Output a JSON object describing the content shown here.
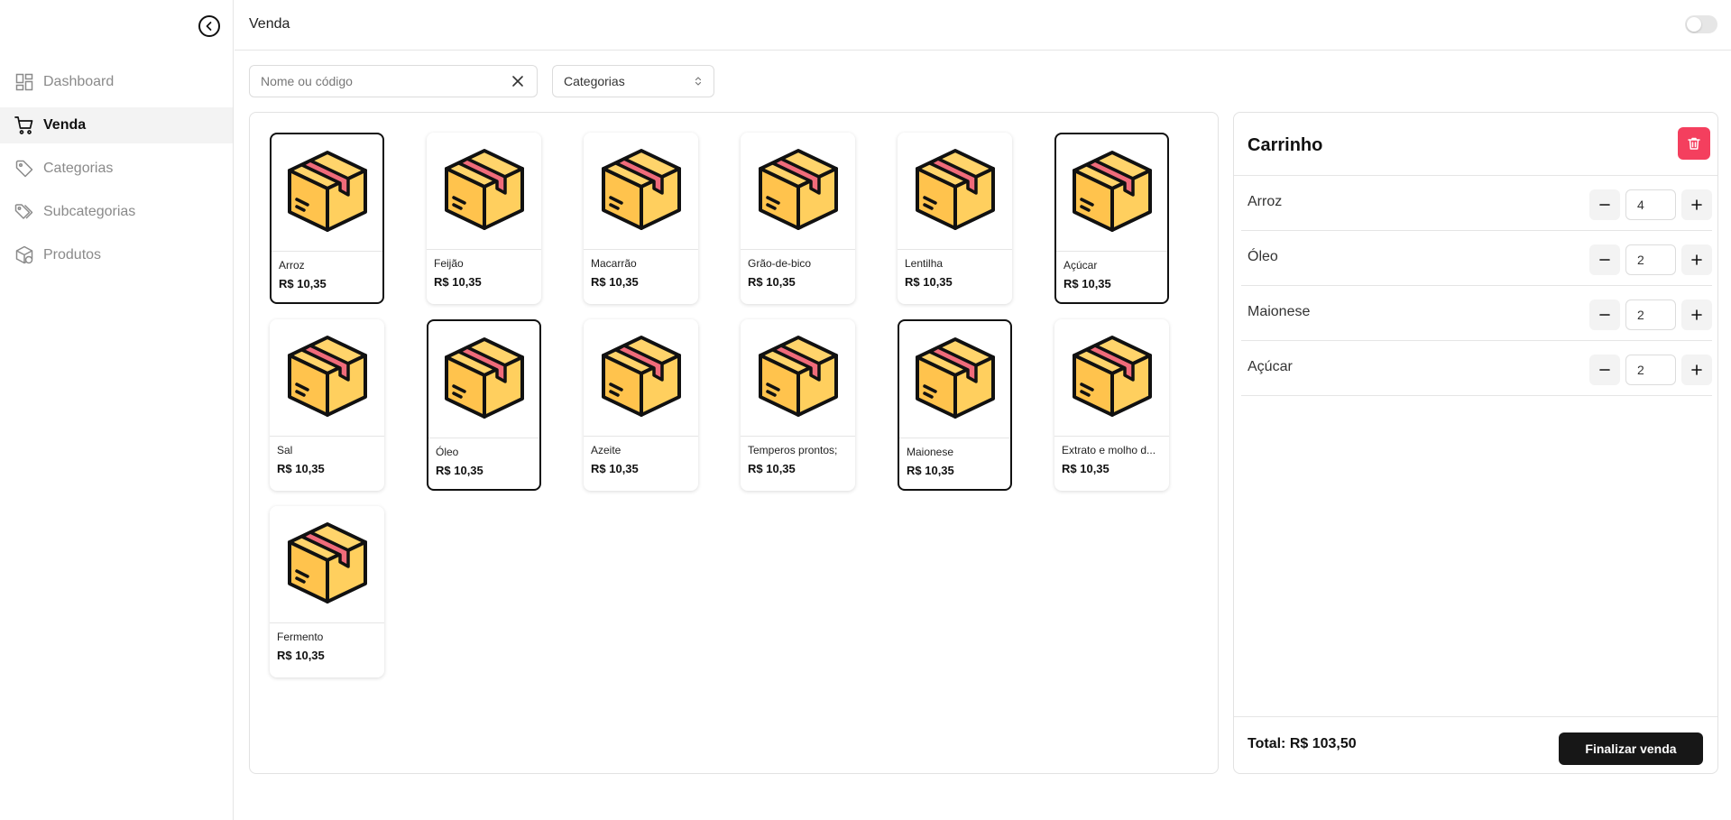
{
  "sidebar": {
    "items": [
      {
        "label": "Dashboard",
        "icon": "dashboard-icon"
      },
      {
        "label": "Venda",
        "icon": "cart-icon"
      },
      {
        "label": "Categorias",
        "icon": "tag-icon"
      },
      {
        "label": "Subcategorias",
        "icon": "tags-icon"
      },
      {
        "label": "Produtos",
        "icon": "package-icon"
      }
    ],
    "active": "Venda"
  },
  "header": {
    "title": "Venda",
    "theme_toggle": "off"
  },
  "filters": {
    "search_placeholder": "Nome ou código",
    "category_select": "Categorias"
  },
  "products": [
    {
      "name": "Arroz",
      "price": "R$ 10,35",
      "selected": true
    },
    {
      "name": "Feijão",
      "price": "R$ 10,35",
      "selected": false
    },
    {
      "name": "Macarrão",
      "price": "R$ 10,35",
      "selected": false
    },
    {
      "name": "Grão-de-bico",
      "price": "R$ 10,35",
      "selected": false
    },
    {
      "name": "Lentilha",
      "price": "R$ 10,35",
      "selected": false
    },
    {
      "name": "Açúcar",
      "price": "R$ 10,35",
      "selected": true
    },
    {
      "name": "Sal",
      "price": "R$ 10,35",
      "selected": false
    },
    {
      "name": "Óleo",
      "price": "R$ 10,35",
      "selected": true
    },
    {
      "name": "Azeite",
      "price": "R$ 10,35",
      "selected": false
    },
    {
      "name": "Temperos prontos;",
      "price": "R$ 10,35",
      "selected": false
    },
    {
      "name": "Maionese",
      "price": "R$ 10,35",
      "selected": true
    },
    {
      "name": "Extrato e molho d...",
      "price": "R$ 10,35",
      "selected": false
    },
    {
      "name": "Fermento",
      "price": "R$ 10,35",
      "selected": false
    }
  ],
  "cart": {
    "title": "Carrinho",
    "items": [
      {
        "name": "Arroz",
        "qty": "4"
      },
      {
        "name": "Óleo",
        "qty": "2"
      },
      {
        "name": "Maionese",
        "qty": "2"
      },
      {
        "name": "Açúcar",
        "qty": "2"
      }
    ],
    "total_label": "Total:",
    "total_value": "R$ 103,50",
    "finish_label": "Finalizar venda"
  },
  "colors": {
    "accent_danger": "#f43f5e",
    "primary": "#171717",
    "box_fill": "#ffc34d",
    "tape": "#f06b7a"
  }
}
